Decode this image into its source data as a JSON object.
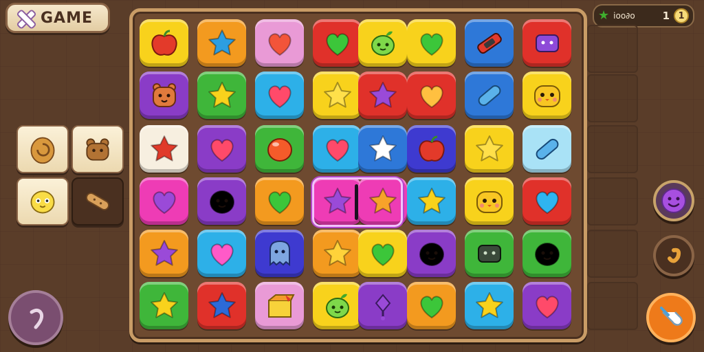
{
  "header": {
    "game_label": "GAME",
    "close_icon": "close-icon"
  },
  "score": {
    "label": "ioo∂o",
    "value": "1",
    "coin_value": "1",
    "icon": "green-star-icon"
  },
  "colors": {
    "yellow": "#f8d21c",
    "orange": "#f39a1f",
    "pink": "#e99ad6",
    "red": "#e0312a",
    "blue": "#2e78d8",
    "green": "#3fb63a",
    "purple": "#8a3cc7",
    "magenta": "#ee3cb5",
    "sky": "#2db0e8",
    "white": "#f7efe0",
    "lightblue": "#a9e2f6",
    "cream": "#f5e2b8",
    "brown": "#6a4424",
    "indigo": "#3e3ad0"
  },
  "board": {
    "rows": [
      [
        {
          "color": "yellow",
          "icon": "apple"
        },
        {
          "color": "orange",
          "icon": "star"
        },
        {
          "color": "pink",
          "icon": "heart"
        },
        {
          "color": "red",
          "icon": "heart"
        },
        {
          "color": "yellow",
          "icon": "sprout-face"
        },
        {
          "color": "yellow",
          "icon": "heart"
        },
        {
          "color": "blue",
          "icon": "bandage"
        },
        {
          "color": "red",
          "icon": "purple-block"
        }
      ],
      [
        {
          "color": "purple",
          "icon": "bear-face"
        },
        {
          "color": "green",
          "icon": "star"
        },
        {
          "color": "sky",
          "icon": "heart"
        },
        {
          "color": "yellow",
          "icon": "star"
        },
        {
          "color": "red",
          "icon": "star"
        },
        {
          "color": "red",
          "icon": "heart"
        },
        {
          "color": "blue",
          "icon": "pill"
        },
        {
          "color": "yellow",
          "icon": "chick-face"
        }
      ],
      [
        {
          "color": "white",
          "icon": "star"
        },
        {
          "color": "purple",
          "icon": "heart"
        },
        {
          "color": "green",
          "icon": "blob"
        },
        {
          "color": "sky",
          "icon": "heart"
        },
        {
          "color": "blue",
          "icon": "star"
        },
        {
          "color": "indigo",
          "icon": "apple"
        },
        {
          "color": "yellow",
          "icon": "star"
        },
        {
          "color": "lightblue",
          "icon": "pill"
        }
      ],
      [
        {
          "color": "magenta",
          "icon": "heart"
        },
        {
          "color": "purple",
          "icon": "blob-face"
        },
        {
          "color": "orange",
          "icon": "heart"
        },
        {
          "color": "magenta",
          "icon": "star"
        },
        {
          "color": "magenta",
          "icon": "star"
        },
        {
          "color": "sky",
          "icon": "star"
        },
        {
          "color": "yellow",
          "icon": "chick-face"
        },
        {
          "color": "red",
          "icon": "heart"
        }
      ],
      [
        {
          "color": "orange",
          "icon": "star"
        },
        {
          "color": "sky",
          "icon": "heart"
        },
        {
          "color": "indigo",
          "icon": "ghost-face"
        },
        {
          "color": "orange",
          "icon": "star"
        },
        {
          "color": "yellow",
          "icon": "heart"
        },
        {
          "color": "purple",
          "icon": "blob-face"
        },
        {
          "color": "green",
          "icon": "block-face"
        },
        {
          "color": "green",
          "icon": "blob-face"
        }
      ],
      [
        {
          "color": "green",
          "icon": "star"
        },
        {
          "color": "red",
          "icon": "star"
        },
        {
          "color": "pink",
          "icon": "box"
        },
        {
          "color": "yellow",
          "icon": "sprout-face"
        },
        {
          "color": "purple",
          "icon": "balloon"
        },
        {
          "color": "orange",
          "icon": "heart"
        },
        {
          "color": "sky",
          "icon": "star"
        },
        {
          "color": "purple",
          "icon": "heart"
        }
      ]
    ]
  },
  "left_tray": {
    "items": [
      {
        "icon": "cookie-icon",
        "dark": false
      },
      {
        "icon": "bear-cookie-icon",
        "dark": false
      },
      {
        "icon": "chick-icon",
        "dark": false
      },
      {
        "icon": "bandage-icon",
        "dark": true
      }
    ]
  },
  "buttons": {
    "undo": "undo-icon",
    "smile": "smile-icon",
    "swirl": "swirl-icon",
    "hint": "pointer-hand-icon"
  }
}
